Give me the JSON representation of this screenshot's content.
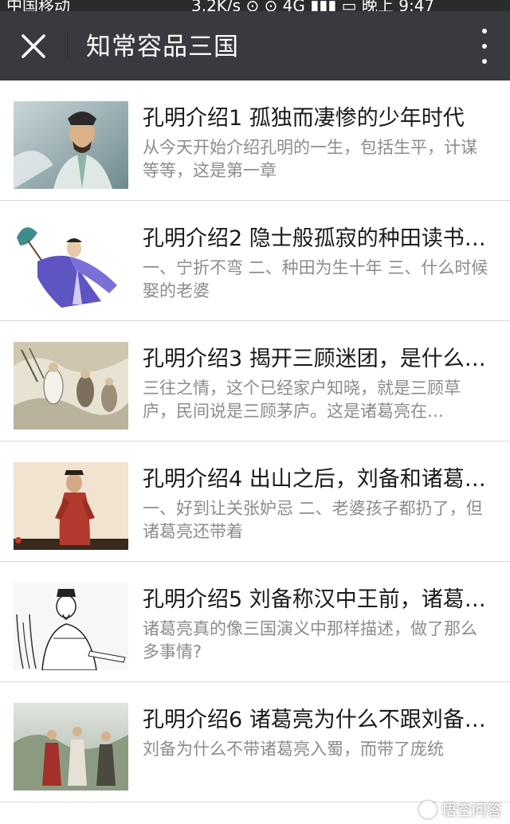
{
  "status_bar": {
    "left_text": "中国移动",
    "right_text": "3.2K/s  ⊙  ⊙   4G  ▮▮▮  ▭  晚上 9:47"
  },
  "header": {
    "title": "知常容品三国",
    "close_icon": "close-icon",
    "more_icon": "more-vertical-icon"
  },
  "articles": [
    {
      "title": "孔明介绍1 孤独而凄惨的少年时代",
      "description": "从今天开始介绍孔明的一生，包括生平，计谋等等，这是第一章"
    },
    {
      "title": "孔明介绍2 隐士般孤寂的种田读书…",
      "description": "一、宁折不弯 二、种田为生十年 三、什么时候娶的老婆"
    },
    {
      "title": "孔明介绍3 揭开三顾迷团，是什么…",
      "description": "三往之情，这个已经家户知晓，就是三顾草庐，民间说是三顾茅庐。这是诸葛亮在…"
    },
    {
      "title": "孔明介绍4 出山之后，刘备和诸葛…",
      "description": "一、好到让关张妒忌 二、老婆孩子都扔了，但诸葛亮还带着"
    },
    {
      "title": "孔明介绍5 刘备称汉中王前，诸葛…",
      "description": "诸葛亮真的像三国演义中那样描述，做了那么多事情?"
    },
    {
      "title": "孔明介绍6 诸葛亮为什么不跟刘备…",
      "description": "刘备为什么不带诸葛亮入蜀，而带了庞统"
    }
  ],
  "watermark": "悟空问答",
  "colors": {
    "header_bg": "#393a3f",
    "title_text": "#1a1a1a",
    "desc_text": "#8c8c8c",
    "divider": "#d9d9d9"
  }
}
